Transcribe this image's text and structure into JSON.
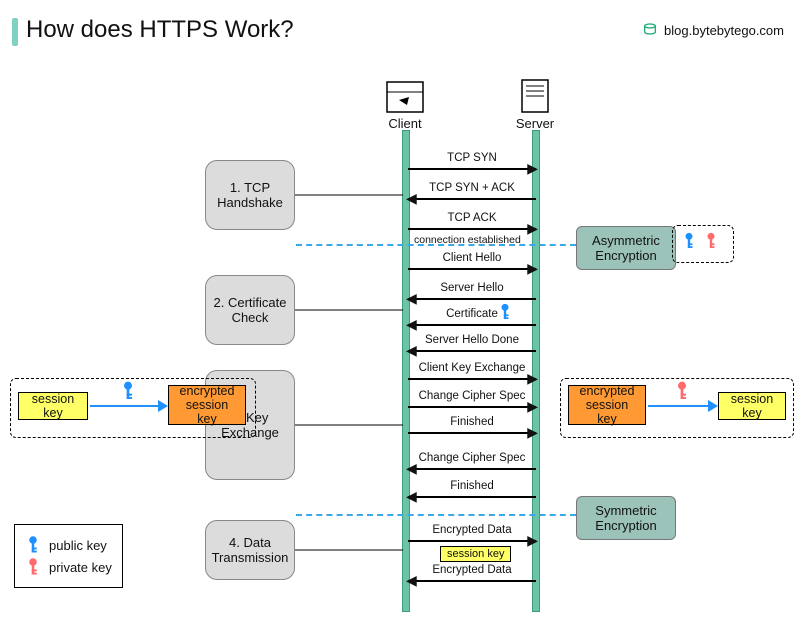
{
  "title": "How does HTTPS Work?",
  "attribution": "blog.bytebytego.com",
  "actors": {
    "client": "Client",
    "server": "Server"
  },
  "phases": {
    "p1": "1. TCP Handshake",
    "p2": "2. Certificate Check",
    "p3": "3. Key Exchange",
    "p4": "4. Data Transmission"
  },
  "messages": {
    "m1": "TCP SYN",
    "m2": "TCP SYN + ACK",
    "m3": "TCP ACK",
    "m4": "Client Hello",
    "m5": "Server Hello",
    "m6": "Certificate",
    "m7": "Server Hello Done",
    "m8": "Client Key Exchange",
    "m9": "Change Cipher Spec",
    "m10": "Finished",
    "m11": "Change Cipher Spec",
    "m12": "Finished",
    "m13": "Encrypted  Data",
    "m14": "Encrypted Data"
  },
  "divider": "connection established",
  "notes": {
    "asym": "Asymmetric Encryption",
    "sym": "Symmetric Encryption"
  },
  "boxes": {
    "session_key": "session key",
    "enc_session_key": "encrypted session key"
  },
  "legend": {
    "public": "public key",
    "private": "private key"
  },
  "inline": {
    "session_key_small": "session key"
  },
  "colors": {
    "key_public": "#1e90ff",
    "key_private": "#ff6b6b"
  }
}
